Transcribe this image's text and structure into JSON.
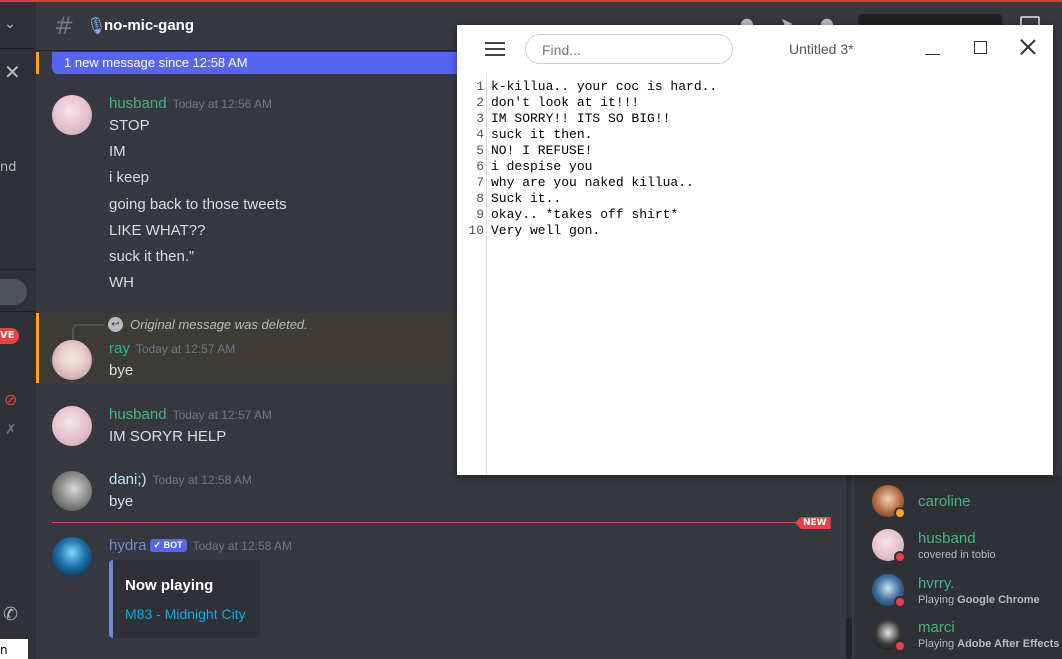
{
  "channel": {
    "name": "no-mic-gang",
    "prefix_icon": "microphone-icon"
  },
  "banner": {
    "text": "1 new message since 12:58 AM"
  },
  "left_strip": {
    "partial_text": "nd",
    "live_label": "VE",
    "bottom_text": "n"
  },
  "messages": [
    {
      "author": "husband",
      "color": "#43b581",
      "time": "Today at 12:56 AM",
      "lines": [
        "STOP",
        "IM",
        "i keep",
        "going back to those tweets",
        "LIKE WHAT??",
        "suck it then.”",
        "WH"
      ]
    },
    {
      "author": "ray",
      "color": "#1abc9c",
      "time": "Today at 12:57 AM",
      "reply": "Original message was deleted.",
      "lines": [
        "bye"
      ]
    },
    {
      "author": "husband",
      "color": "#43b581",
      "time": "Today at 12:57 AM",
      "lines": [
        "IM SORYR HELP"
      ]
    },
    {
      "author": "dani;)",
      "color": "#b5e8f6",
      "time": "Today at 12:58 AM",
      "lines": [
        "bye"
      ]
    },
    {
      "author": "hydra",
      "color": "#7289da",
      "badge": "✓ BOT",
      "time": "Today at 12:58 AM",
      "lines": []
    }
  ],
  "new_tag": "NEW",
  "embed": {
    "title": "Now playing",
    "link": "M83 - Midnight City"
  },
  "members": [
    {
      "name": "caroline",
      "color": "#43b581",
      "sub": "",
      "status": "idle"
    },
    {
      "name": "husband",
      "color": "#43b581",
      "sub": "covered in tobio",
      "status": "dnd"
    },
    {
      "name": "hvrry.",
      "color": "#43b581",
      "sub_prefix": "Playing ",
      "sub_bold": "Google Chrome",
      "status": "dnd"
    },
    {
      "name": "marci",
      "color": "#43b581",
      "sub_prefix": "Playing ",
      "sub_bold": "Adobe After Effects",
      "status": "dnd"
    }
  ],
  "notepad": {
    "find_placeholder": "Find...",
    "title": "Untitled 3*",
    "lines": [
      {
        "n": "1",
        "t": "k-killua.. your coc is hard.."
      },
      {
        "n": "2",
        "t": "don't look at it!!!"
      },
      {
        "n": "3",
        "t": "IM SORRY!! ITS SO BIG!!"
      },
      {
        "n": "4",
        "t": "suck it then."
      },
      {
        "n": "5",
        "t": "NO! I REFUSE!"
      },
      {
        "n": "6",
        "t": "i despise you"
      },
      {
        "n": "7",
        "t": "why are you naked killua.."
      },
      {
        "n": "8",
        "t": "Suck it.."
      },
      {
        "n": "9",
        "t": "okay.. *takes off shirt*"
      },
      {
        "n": "10",
        "t": "Very well gon."
      }
    ]
  }
}
